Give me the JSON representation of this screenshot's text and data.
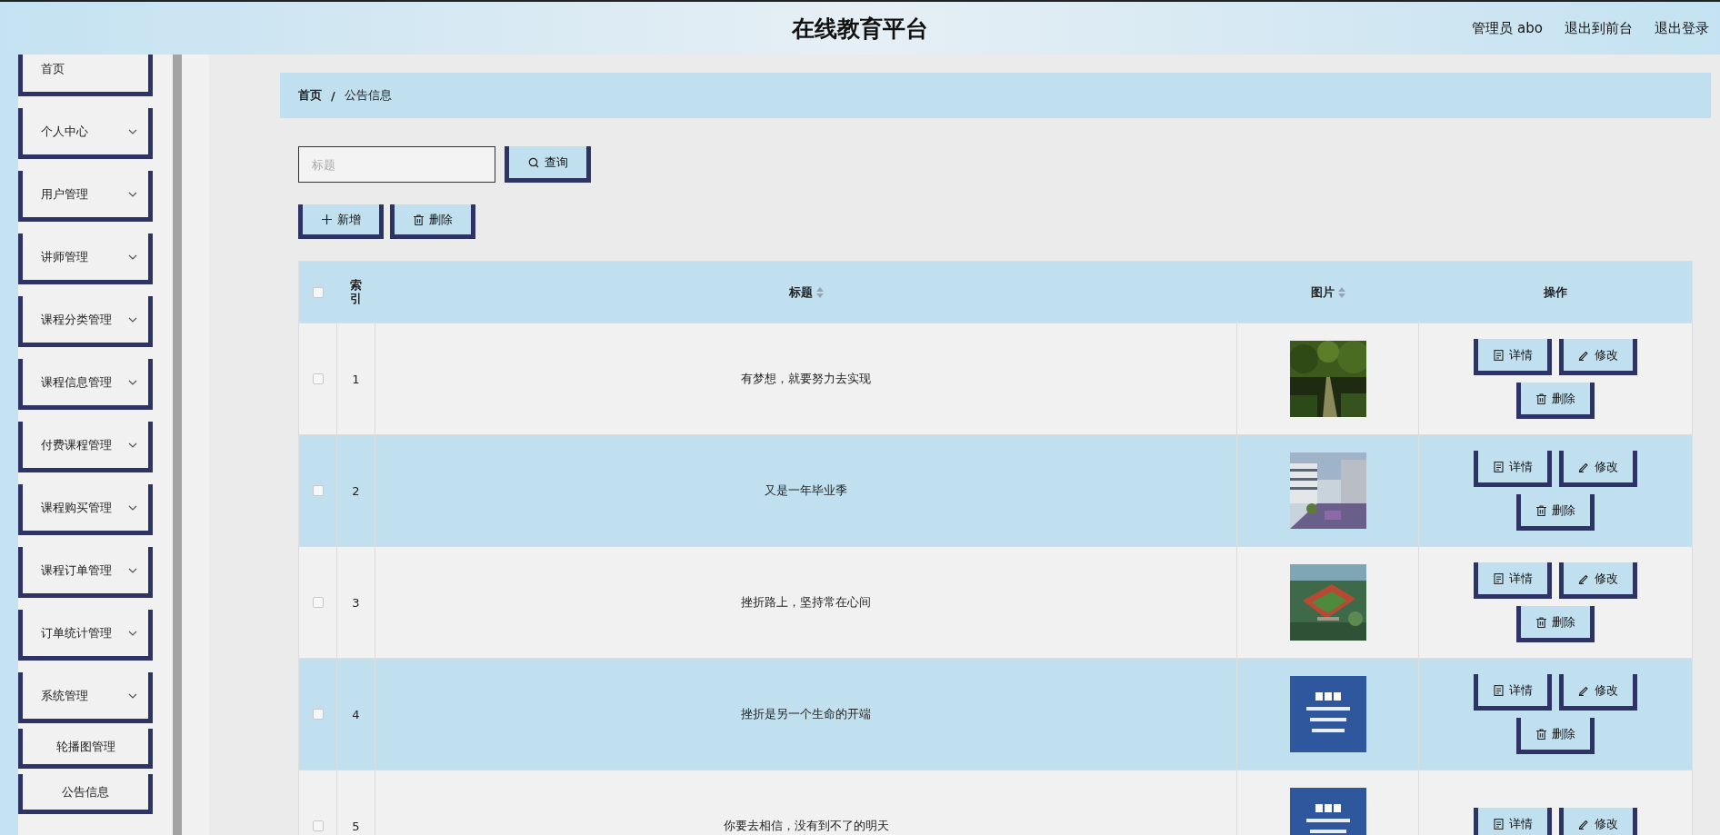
{
  "header": {
    "title": "在线教育平台",
    "links": [
      "管理员 abo",
      "退出到前台",
      "退出登录"
    ]
  },
  "sidebar": {
    "items": [
      {
        "label": "首页",
        "kind": "link"
      },
      {
        "label": "个人中心",
        "kind": "group"
      },
      {
        "label": "用户管理",
        "kind": "group"
      },
      {
        "label": "讲师管理",
        "kind": "group"
      },
      {
        "label": "课程分类管理",
        "kind": "group"
      },
      {
        "label": "课程信息管理",
        "kind": "group"
      },
      {
        "label": "付费课程管理",
        "kind": "group"
      },
      {
        "label": "课程购买管理",
        "kind": "group"
      },
      {
        "label": "课程订单管理",
        "kind": "group"
      },
      {
        "label": "订单统计管理",
        "kind": "group"
      },
      {
        "label": "系统管理",
        "kind": "group",
        "children": [
          {
            "label": "轮播图管理"
          },
          {
            "label": "公告信息"
          }
        ]
      }
    ]
  },
  "breadcrumb": [
    "首页",
    "/",
    "公告信息"
  ],
  "search": {
    "placeholder": "标题",
    "button": "查询"
  },
  "toolbar": [
    {
      "label": "新增",
      "kind": "add"
    },
    {
      "label": "删除",
      "kind": "delete"
    }
  ],
  "table": {
    "select_all_checked": false,
    "columns": [
      {
        "label": "索引",
        "sortable": false
      },
      {
        "label": "标题",
        "sortable": true
      },
      {
        "label": "图片",
        "sortable": true
      },
      {
        "label": "操作",
        "sortable": false
      }
    ],
    "rows": [
      {
        "checked": false,
        "index": "1",
        "title": "有梦想，就要努力去实现",
        "image": {
          "kind": "picture"
        },
        "actions": [
          "详情",
          "修改",
          "删除"
        ]
      },
      {
        "checked": false,
        "index": "2",
        "title": "又是一年毕业季",
        "image": {
          "kind": "picture"
        },
        "actions": [
          "详情",
          "修改",
          "删除"
        ]
      },
      {
        "checked": false,
        "index": "3",
        "title": "挫折路上，坚持常在心间",
        "image": {
          "kind": "picture"
        },
        "actions": [
          "详情",
          "修改",
          "删除"
        ]
      },
      {
        "checked": false,
        "index": "4",
        "title": "挫折是另一个生命的开端",
        "image": {
          "kind": "picture"
        },
        "actions": [
          "详情",
          "修改",
          "删除"
        ]
      },
      {
        "checked": false,
        "index": "5",
        "title": "你要去相信，没有到不了的明天",
        "image": {
          "kind": "picture"
        },
        "actions": [
          "详情",
          "修改"
        ]
      }
    ]
  }
}
